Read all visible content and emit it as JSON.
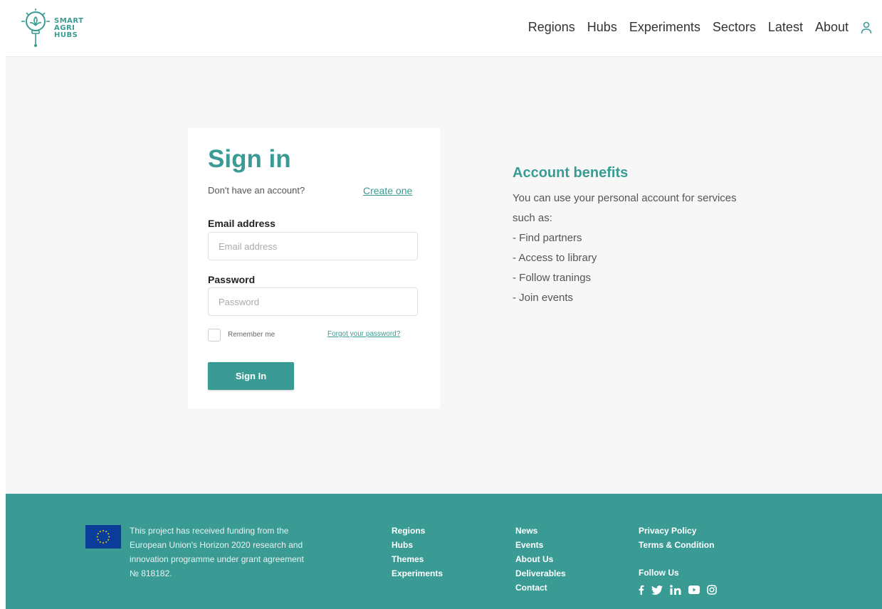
{
  "logo": {
    "line1": "SMART",
    "line2": "AGRI",
    "line3": "HUBS"
  },
  "nav": {
    "items": [
      "Regions",
      "Hubs",
      "Experiments",
      "Sectors",
      "Latest",
      "About"
    ],
    "user_icon": "user-icon"
  },
  "signin": {
    "title": "Sign in",
    "no_account": "Don't have an account?",
    "create_link": "Create one",
    "email_label": "Email address",
    "email_placeholder": "Email address",
    "email_value": "",
    "password_label": "Password",
    "password_placeholder": "Password",
    "password_value": "",
    "remember_label": "Remember me",
    "remember_checked": false,
    "forgot_link": "Forgot your password?",
    "submit_label": "Sign In"
  },
  "benefits": {
    "title": "Account benefits",
    "intro": "You can use your personal account for services such as:",
    "items": [
      "- Find partners",
      "- Access to library",
      "- Follow tranings",
      "- Join events"
    ]
  },
  "footer": {
    "funding": "This project has received funding from the European Union's Horizon 2020 research and innovation programme under grant agreement № 818182.",
    "col1": [
      "Regions",
      "Hubs",
      "Themes",
      "Experiments"
    ],
    "col2": [
      "News",
      "Events",
      "About Us",
      "Deliverables",
      "Contact"
    ],
    "col3": [
      "Privacy Policy",
      "Terms & Condition"
    ],
    "follow_title": "Follow Us",
    "social_icons": [
      "facebook-icon",
      "twitter-icon",
      "linkedin-icon",
      "youtube-icon",
      "instagram-icon"
    ]
  },
  "colors": {
    "accent": "#3a9b94",
    "eu_blue": "#0a3d9a",
    "eu_star": "#ffcc00"
  }
}
